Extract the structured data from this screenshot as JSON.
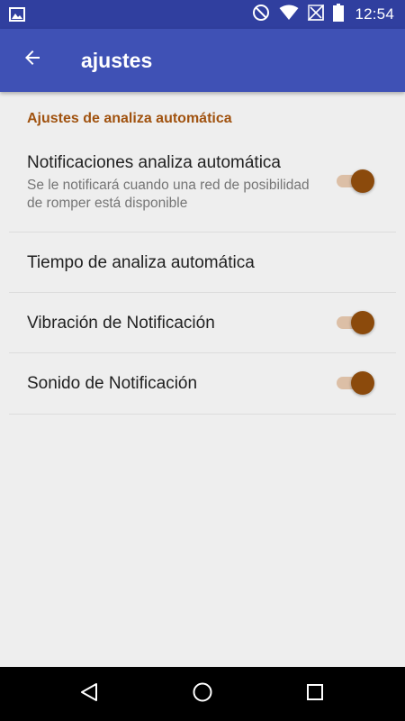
{
  "status_bar": {
    "time": "12:54",
    "icons": [
      "image-notification-icon",
      "do-not-disturb-icon",
      "wifi-icon",
      "no-signal-icon",
      "battery-icon"
    ]
  },
  "toolbar": {
    "back_icon": "arrow-back-icon",
    "title": "ajustes"
  },
  "settings": {
    "section_header": "Ajustes de analiza automática",
    "items": [
      {
        "label": "Notificaciones analiza automática",
        "summary": "Se le notificará cuando una red de posibilidad de romper está disponible",
        "switch_on": true
      },
      {
        "label": "Tiempo de analiza automática"
      },
      {
        "label": "Vibración de Notificación",
        "switch_on": true
      },
      {
        "label": "Sonido de Notificación",
        "switch_on": true
      }
    ]
  },
  "nav_bar": {
    "buttons": [
      "back-triangle-icon",
      "home-circle-icon",
      "recents-square-icon"
    ]
  },
  "colors": {
    "status_bar": "#303f9f",
    "toolbar": "#3f51b5",
    "accent": "#a0520f",
    "switch_thumb": "#8b4a0c",
    "switch_track": "#dcbfa6",
    "background": "#eeeeee"
  }
}
